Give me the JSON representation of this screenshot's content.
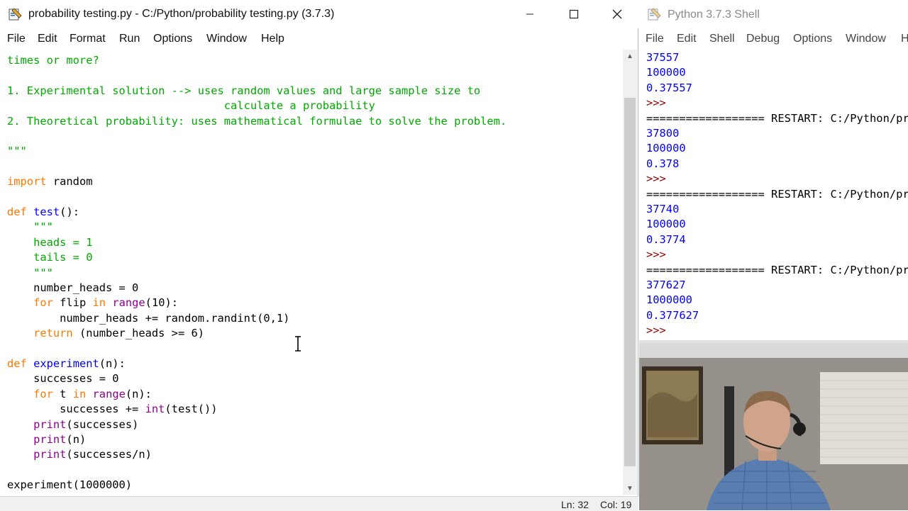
{
  "editor": {
    "title": "probability testing.py - C:/Python/probability testing.py (3.7.3)",
    "menu": [
      "File",
      "Edit",
      "Format",
      "Run",
      "Options",
      "Window",
      "Help"
    ],
    "status": {
      "ln": "Ln: 32",
      "col": "Col: 19"
    }
  },
  "code": [
    [
      {
        "t": "times or more?",
        "c": "str"
      }
    ],
    [],
    [
      {
        "t": "1. Experimental solution --> uses random values and large sample size to",
        "c": "str"
      }
    ],
    [
      {
        "t": "                                 calculate a probability",
        "c": "str"
      }
    ],
    [
      {
        "t": "2. Theoretical probability: uses mathematical formulae to solve the problem.",
        "c": "str"
      }
    ],
    [],
    [
      {
        "t": "\"\"\"",
        "c": "str"
      }
    ],
    [],
    [
      {
        "t": "import",
        "c": "kw"
      },
      {
        "t": " random"
      }
    ],
    [],
    [
      {
        "t": "def",
        "c": "kw"
      },
      {
        "t": " "
      },
      {
        "t": "test",
        "c": "def"
      },
      {
        "t": "():"
      }
    ],
    [
      {
        "t": "    "
      },
      {
        "t": "\"\"\"",
        "c": "str"
      }
    ],
    [
      {
        "t": "    "
      },
      {
        "t": "heads = 1",
        "c": "str"
      }
    ],
    [
      {
        "t": "    "
      },
      {
        "t": "tails = 0",
        "c": "str"
      }
    ],
    [
      {
        "t": "    "
      },
      {
        "t": "\"\"\"",
        "c": "str"
      }
    ],
    [
      {
        "t": "    number_heads = 0"
      }
    ],
    [
      {
        "t": "    "
      },
      {
        "t": "for",
        "c": "kw"
      },
      {
        "t": " flip "
      },
      {
        "t": "in",
        "c": "kw"
      },
      {
        "t": " "
      },
      {
        "t": "range",
        "c": "bi"
      },
      {
        "t": "(10):"
      }
    ],
    [
      {
        "t": "        number_heads += random.randint(0,1)"
      }
    ],
    [
      {
        "t": "    "
      },
      {
        "t": "return",
        "c": "kw"
      },
      {
        "t": " (number_heads >= 6)"
      }
    ],
    [],
    [
      {
        "t": "def",
        "c": "kw"
      },
      {
        "t": " "
      },
      {
        "t": "experiment",
        "c": "def"
      },
      {
        "t": "(n):"
      }
    ],
    [
      {
        "t": "    successes = 0"
      }
    ],
    [
      {
        "t": "    "
      },
      {
        "t": "for",
        "c": "kw"
      },
      {
        "t": " t "
      },
      {
        "t": "in",
        "c": "kw"
      },
      {
        "t": " "
      },
      {
        "t": "range",
        "c": "bi"
      },
      {
        "t": "(n):"
      }
    ],
    [
      {
        "t": "        successes += "
      },
      {
        "t": "int",
        "c": "bi"
      },
      {
        "t": "(test())"
      }
    ],
    [
      {
        "t": "    "
      },
      {
        "t": "print",
        "c": "bi"
      },
      {
        "t": "(successes)"
      }
    ],
    [
      {
        "t": "    "
      },
      {
        "t": "print",
        "c": "bi"
      },
      {
        "t": "(n)"
      }
    ],
    [
      {
        "t": "    "
      },
      {
        "t": "print",
        "c": "bi"
      },
      {
        "t": "(successes/n)"
      }
    ],
    [],
    [
      {
        "t": "experiment(1000000)"
      }
    ]
  ],
  "shell": {
    "title": "Python 3.7.3 Shell",
    "menu": [
      "File",
      "Edit",
      "Shell",
      "Debug",
      "Options",
      "Window",
      "Help"
    ],
    "lines": [
      {
        "t": "37557",
        "k": "out"
      },
      {
        "t": "100000",
        "k": "out"
      },
      {
        "t": "0.37557",
        "k": "out"
      },
      {
        "t": ">>>",
        "k": "prompt"
      },
      {
        "t": "================== RESTART: C:/Python/probability testing.py",
        "k": "restart"
      },
      {
        "t": "37800",
        "k": "out"
      },
      {
        "t": "100000",
        "k": "out"
      },
      {
        "t": "0.378",
        "k": "out"
      },
      {
        "t": ">>>",
        "k": "prompt"
      },
      {
        "t": "================== RESTART: C:/Python/probability testing.py",
        "k": "restart"
      },
      {
        "t": "37740",
        "k": "out"
      },
      {
        "t": "100000",
        "k": "out"
      },
      {
        "t": "0.3774",
        "k": "out"
      },
      {
        "t": ">>>",
        "k": "prompt"
      },
      {
        "t": "================== RESTART: C:/Python/probability testing.py",
        "k": "restart"
      },
      {
        "t": "377627",
        "k": "out"
      },
      {
        "t": "1000000",
        "k": "out"
      },
      {
        "t": "0.377627",
        "k": "out"
      },
      {
        "t": ">>>",
        "k": "prompt"
      }
    ]
  },
  "icons": {
    "app": "python-idle-icon",
    "minimize": "minimize-icon",
    "maximize": "maximize-icon",
    "close": "close-icon",
    "cursor": "text-cursor-icon"
  }
}
